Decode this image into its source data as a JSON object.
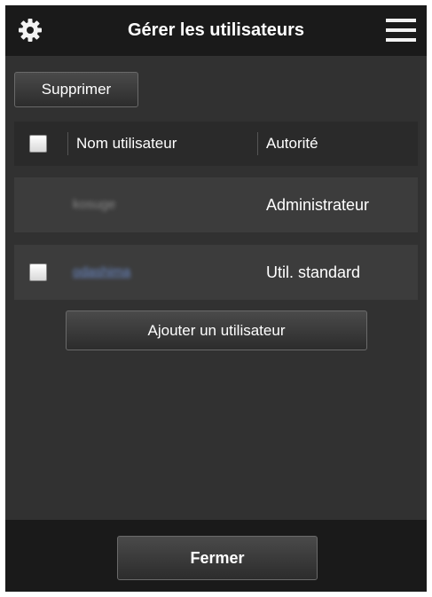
{
  "header": {
    "title": "Gérer les utilisateurs",
    "settings_icon": "gear-icon",
    "menu_icon": "hamburger-menu-icon"
  },
  "toolbar": {
    "delete_label": "Supprimer"
  },
  "table": {
    "columns": [
      "Nom utilisateur",
      "Autorité"
    ],
    "rows": [
      {
        "name": "kosuge",
        "authority": "Administrateur",
        "selectable": false,
        "is_link": false
      },
      {
        "name": "odashima",
        "authority": "Util. standard",
        "selectable": true,
        "is_link": true
      }
    ]
  },
  "actions": {
    "add_user_label": "Ajouter un utilisateur"
  },
  "footer": {
    "close_label": "Fermer"
  },
  "colors": {
    "background": "#313131",
    "header_bar": "#1a1a1a",
    "row": "#3c3c3c",
    "link": "#6f8fd0"
  }
}
